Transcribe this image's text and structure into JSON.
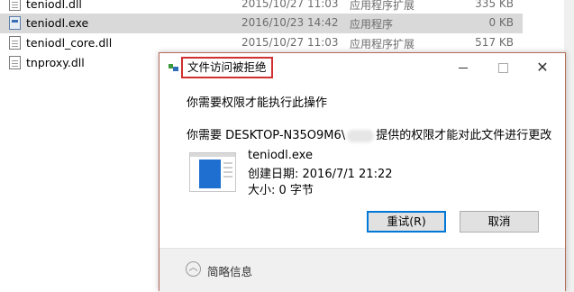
{
  "files": [
    {
      "name": "teniodl.dll",
      "date": "2015/10/27 11:03",
      "type": "应用程序扩展",
      "size": "335 KB",
      "icon": "dll-file-icon",
      "selected": false
    },
    {
      "name": "teniodl.exe",
      "date": "2016/10/23 14:42",
      "type": "应用程序",
      "size": "0 KB",
      "icon": "exe-file-icon",
      "selected": true
    },
    {
      "name": "teniodl_core.dll",
      "date": "2015/10/27 11:03",
      "type": "应用程序扩展",
      "size": "517 KB",
      "icon": "dll-file-icon",
      "selected": false
    },
    {
      "name": "tnproxy.dll",
      "date": "",
      "type": "",
      "size": "",
      "icon": "dll-file-icon",
      "selected": false
    }
  ],
  "dialog": {
    "title": "文件访问被拒绝",
    "message1": "你需要权限才能执行此操作",
    "message2_prefix": "你需要 DESKTOP-N35O9M6\\",
    "message2_suffix": "提供的权限才能对此文件进行更改",
    "file_name": "teniodl.exe",
    "file_created": "创建日期: 2016/7/1 21:22",
    "file_size": "大小: 0 字节",
    "retry_label": "重试(R)",
    "cancel_label": "取消",
    "details_label": "简略信息",
    "close_glyph": "✕"
  },
  "colors": {
    "highlight_border": "#d03030",
    "selected_row": "#d9d9d9",
    "accent": "#0078d7"
  }
}
